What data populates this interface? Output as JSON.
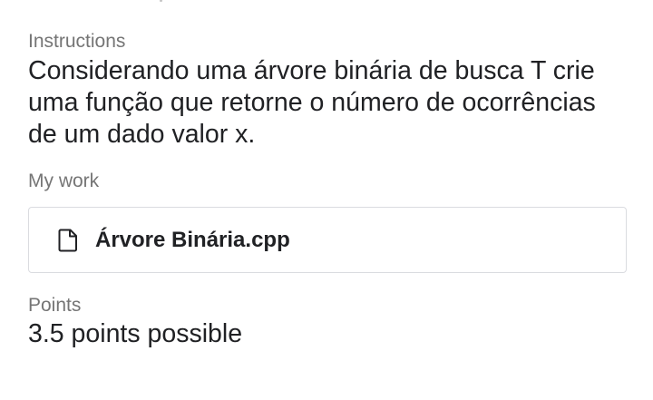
{
  "instructions": {
    "label": "Instructions",
    "text": "Considerando uma árvore binária de busca T crie uma função que retorne o número de ocorrências de um dado valor x."
  },
  "my_work": {
    "label": "My work",
    "attachment": {
      "file_name": "Árvore Binária.cpp",
      "icon": "file-icon"
    }
  },
  "points": {
    "label": "Points",
    "value": "3.5 points possible"
  }
}
